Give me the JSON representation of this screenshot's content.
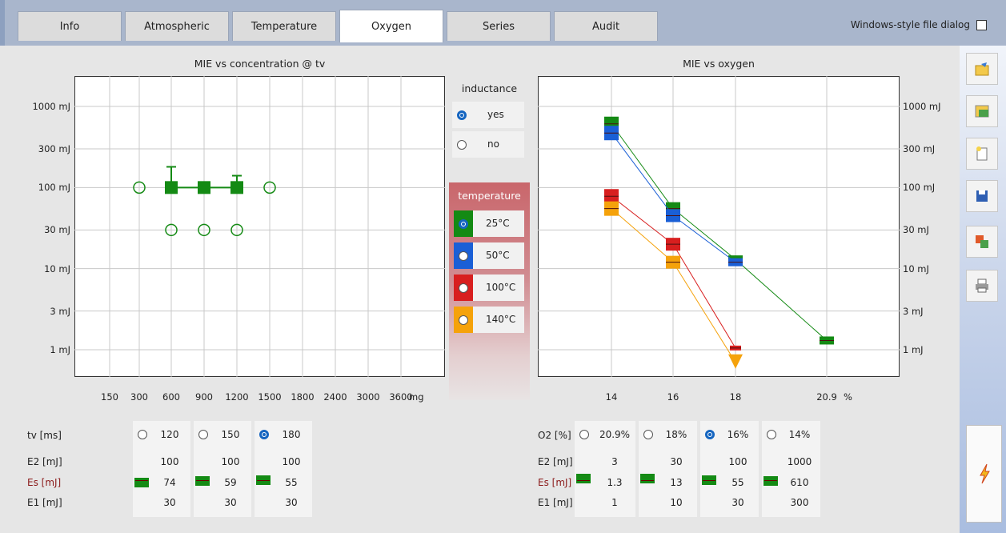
{
  "tabs": [
    "Info",
    "Atmospheric",
    "Temperature",
    "Oxygen",
    "Series",
    "Audit"
  ],
  "active_tab": "Oxygen",
  "windows_dialog_label": "Windows-style file dialog",
  "left_plot": {
    "title": "MIE  vs  concentration  @  tv",
    "x_ticks": [
      "150",
      "300",
      "600",
      "900",
      "1200",
      "1500",
      "1800",
      "2400",
      "3000",
      "3600"
    ],
    "x_unit": "mg",
    "y_ticks": [
      "1000 mJ",
      "300 mJ",
      "100 mJ",
      "30 mJ",
      "10 mJ",
      "3 mJ",
      "1 mJ"
    ]
  },
  "right_plot": {
    "title": "MIE  vs  oxygen",
    "x_ticks": [
      "14",
      "16",
      "18",
      "20.9"
    ],
    "x_unit": "%",
    "y_ticks": [
      "1000 mJ",
      "300 mJ",
      "100 mJ",
      "30 mJ",
      "10 mJ",
      "3 mJ",
      "1 mJ"
    ]
  },
  "inductance": {
    "title": "inductance",
    "options": [
      "yes",
      "no"
    ],
    "selected": "yes"
  },
  "temperature": {
    "title": "temperature",
    "options": [
      {
        "label": "25°C",
        "color": "#148a14"
      },
      {
        "label": "50°C",
        "color": "#1a5fd6"
      },
      {
        "label": "100°C",
        "color": "#d81f1f"
      },
      {
        "label": "140°C",
        "color": "#f5a20b"
      }
    ],
    "selected": "25°C"
  },
  "chart_data": [
    {
      "type": "scatter",
      "title": "MIE  vs  concentration  @  tv",
      "xlabel": "mg",
      "ylabel": "",
      "yscale": "log",
      "categories": [
        "150",
        "300",
        "600",
        "900",
        "1200",
        "1500",
        "1800",
        "2400",
        "3000",
        "3600"
      ],
      "series": [
        {
          "values": [
            {
              "x": "600",
              "y": 100
            },
            {
              "x": "900",
              "y": 100
            },
            {
              "x": "1200",
              "y": 100
            }
          ],
          "error_up": [
            {
              "x": "600",
              "y": 180
            },
            {
              "x": "1200",
              "y": 140
            }
          ]
        },
        {
          "values": [
            {
              "x": "300",
              "y": 100
            },
            {
              "x": "1500",
              "y": 100
            },
            {
              "x": "600",
              "y": 30
            },
            {
              "x": "900",
              "y": 30
            },
            {
              "x": "1200",
              "y": 30
            }
          ]
        }
      ],
      "grid": true
    },
    {
      "type": "line",
      "title": "MIE  vs  oxygen",
      "xlabel": "%",
      "ylabel": "",
      "yscale": "log",
      "categories": [
        "14",
        "16",
        "18",
        "20.9"
      ],
      "series": [
        {
          "name": "25°C",
          "values": [
            610,
            55,
            13,
            1.3
          ]
        },
        {
          "name": "50°C",
          "values": [
            470,
            45,
            12,
            null
          ]
        },
        {
          "name": "100°C",
          "values": [
            78,
            20,
            null,
            null
          ],
          "last_point": {
            "x": "18",
            "y": 1.05
          }
        },
        {
          "name": "140°C",
          "values": [
            55,
            12,
            null,
            null
          ],
          "last_point": {
            "x": "18",
            "y": 0.7
          }
        }
      ],
      "grid": true
    }
  ],
  "tv_table": {
    "row_labels": [
      "tv [ms]",
      "E2 [mJ]",
      "Es [mJ]",
      "E1 [mJ]"
    ],
    "columns": [
      {
        "header": "120",
        "e2": "100",
        "es": "74",
        "e1": "30",
        "selected": false
      },
      {
        "header": "150",
        "e2": "100",
        "es": "59",
        "e1": "30",
        "selected": false
      },
      {
        "header": "180",
        "e2": "100",
        "es": "55",
        "e1": "30",
        "selected": true
      }
    ]
  },
  "o2_table": {
    "row_labels": [
      "O2 [%]",
      "E2 [mJ]",
      "Es [mJ]",
      "E1 [mJ]"
    ],
    "columns": [
      {
        "header": "20.9%",
        "e2": "3",
        "es": "1.3",
        "e1": "1",
        "selected": false
      },
      {
        "header": "18%",
        "e2": "30",
        "es": "13",
        "e1": "10",
        "selected": false
      },
      {
        "header": "16%",
        "e2": "100",
        "es": "55",
        "e1": "30",
        "selected": true
      },
      {
        "header": "14%",
        "e2": "1000",
        "es": "610",
        "e1": "300",
        "selected": false
      }
    ]
  },
  "sidebar_buttons": [
    "open-folder-icon",
    "select-image-icon",
    "new-document-icon",
    "save-disk-icon",
    "export-icon",
    "print-icon"
  ],
  "action_button_icon": "lightning-icon"
}
